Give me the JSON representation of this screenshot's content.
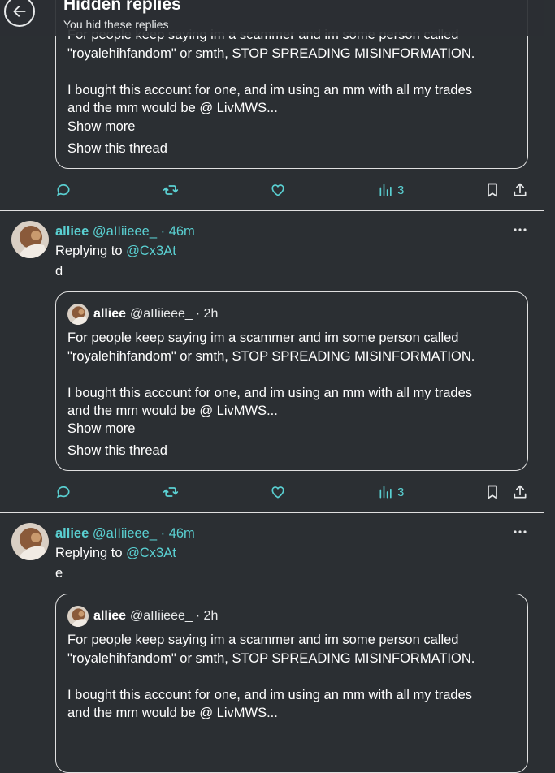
{
  "header": {
    "title": "Hidden replies",
    "subtitle": "You hid these replies"
  },
  "quoted_tweet": {
    "name": "alliee",
    "handle": "@aIIiieee_",
    "time": "· 2h",
    "line1": "For people keep saying im a scammer and im some person called",
    "line2": "\"royalehihfandom\" or smth, STOP SPREADING MISINFORMATION.",
    "line3": "I bought this account for one, and im using an mm with all my trades",
    "line4": "and the mm would be @ LivMWS...",
    "show_more": "Show more",
    "show_thread": "Show this thread"
  },
  "top_quote": {
    "line1_partial": "For people keep saying im a scammer and im some person called"
  },
  "actions": {
    "views": "3"
  },
  "replies": [
    {
      "name": "alliee",
      "handle": "@aIIiieee_",
      "time": "· 46m",
      "replying_label": "Replying to ",
      "replying_to": "@Cx3At",
      "text": "d"
    },
    {
      "name": "alliee",
      "handle": "@aIIiieee_",
      "time": "· 46m",
      "replying_label": "Replying to ",
      "replying_to": "@Cx3At",
      "text": "e"
    }
  ],
  "icons": {
    "back": "arrow-left-icon",
    "reply": "speech-bubble-icon",
    "retweet": "retweet-icon",
    "like": "heart-icon",
    "views": "bar-chart-icon",
    "bookmark": "bookmark-icon",
    "share": "share-icon",
    "more": "ellipsis-icon"
  },
  "colors": {
    "background": "#2b2f33",
    "accent": "#5ad0d2",
    "text": "#ffffff",
    "border": "#e0e0e0"
  }
}
